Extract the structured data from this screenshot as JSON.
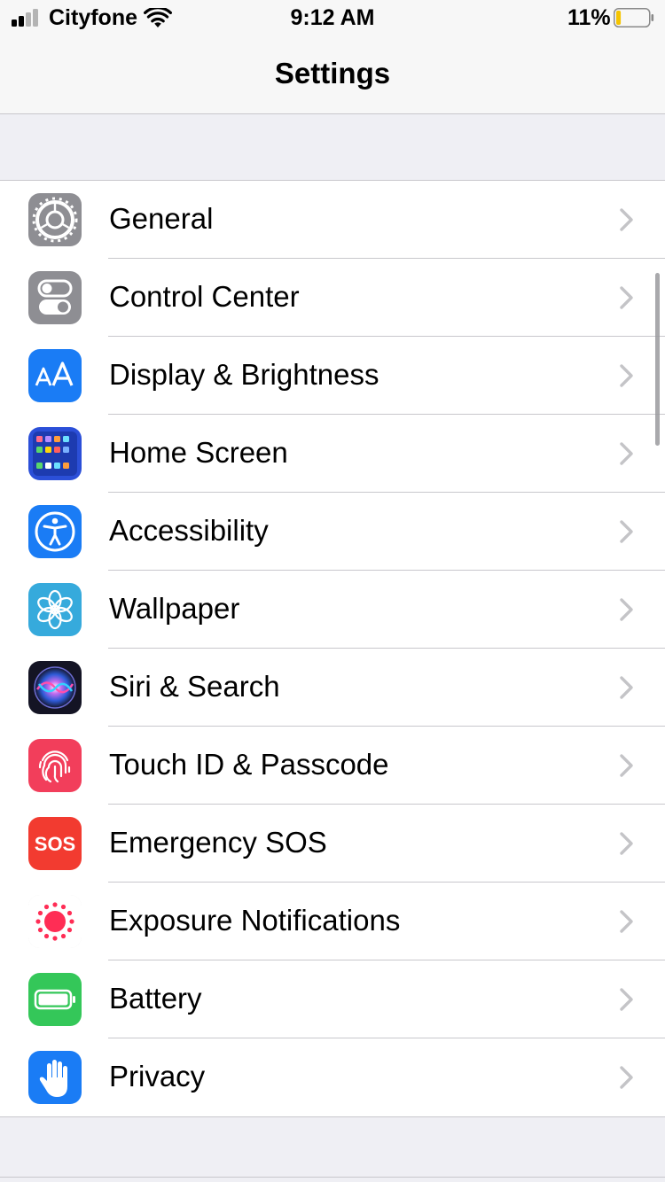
{
  "status_bar": {
    "carrier": "Cityfone",
    "time": "9:12 AM",
    "battery_percent": "11%",
    "battery_level": 0.11,
    "signal_bars_active": 2,
    "signal_bars_total": 4
  },
  "nav": {
    "title": "Settings"
  },
  "settings": [
    {
      "label": "General",
      "icon": "gear-icon",
      "color": "#8e8e93"
    },
    {
      "label": "Control Center",
      "icon": "toggles-icon",
      "color": "#8e8e93"
    },
    {
      "label": "Display & Brightness",
      "icon": "text-size-icon",
      "color": "#1a7cf5"
    },
    {
      "label": "Home Screen",
      "icon": "app-grid-icon",
      "color": "#2b4fd8"
    },
    {
      "label": "Accessibility",
      "icon": "accessibility-icon",
      "color": "#1a7cf5"
    },
    {
      "label": "Wallpaper",
      "icon": "flower-icon",
      "color": "#36aadc"
    },
    {
      "label": "Siri & Search",
      "icon": "siri-icon",
      "color": "#1c1c2e"
    },
    {
      "label": "Touch ID & Passcode",
      "icon": "fingerprint-icon",
      "color": "#f23e5b"
    },
    {
      "label": "Emergency SOS",
      "icon": "sos-icon",
      "color": "#f23b30",
      "icon_text": "SOS"
    },
    {
      "label": "Exposure Notifications",
      "icon": "exposure-icon",
      "color": "#ffffff"
    },
    {
      "label": "Battery",
      "icon": "battery-icon",
      "color": "#34c759"
    },
    {
      "label": "Privacy",
      "icon": "hand-icon",
      "color": "#1a7cf5"
    }
  ]
}
